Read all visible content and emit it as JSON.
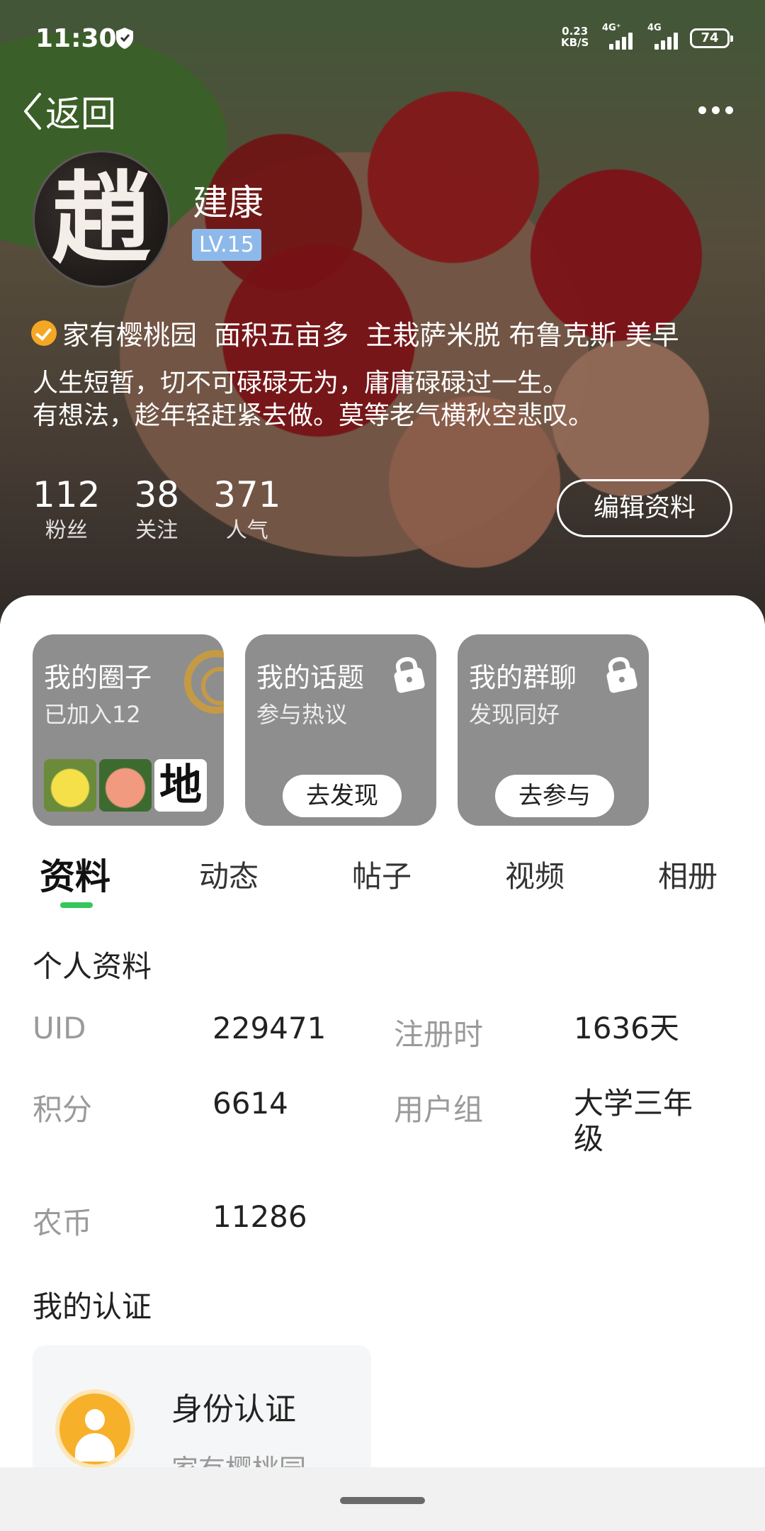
{
  "status_bar": {
    "time": "11:30",
    "net_speed_value": "0.23",
    "net_speed_unit": "KB/S",
    "signal1_label": "4G⁺",
    "signal2_label": "4G",
    "battery": "74"
  },
  "header": {
    "back_label": "返回",
    "avatar_glyph": "趙",
    "username": "建康",
    "level": "LV.15",
    "verification": "家有樱桃园  面积五亩多  主栽萨米脱 布鲁克斯 美早",
    "bio_line1": "人生短暂，切不可碌碌无为，庸庸碌碌过一生。",
    "bio_line2": "有想法，趁年轻赶紧去做。莫等老气横秋空悲叹。",
    "stats": [
      {
        "value": "112",
        "label": "粉丝"
      },
      {
        "value": "38",
        "label": "关注"
      },
      {
        "value": "371",
        "label": "人气"
      }
    ],
    "edit_button": "编辑资料"
  },
  "cards": [
    {
      "title": "我的圈子",
      "subtitle": "已加入12",
      "thumb_char": "地"
    },
    {
      "title": "我的话题",
      "subtitle": "参与热议",
      "button": "去发现"
    },
    {
      "title": "我的群聊",
      "subtitle": "发现同好",
      "button": "去参与"
    }
  ],
  "tabs": [
    "资料",
    "动态",
    "帖子",
    "视频",
    "相册"
  ],
  "active_tab": "资料",
  "profile": {
    "section_title": "个人资料",
    "fields": [
      {
        "key": "UID",
        "value": "229471"
      },
      {
        "key": "注册时",
        "value": "1636天"
      },
      {
        "key": "积分",
        "value": "6614"
      },
      {
        "key": "用户组",
        "value": "大学三年级"
      },
      {
        "key": "农币",
        "value": "11286"
      }
    ]
  },
  "certification": {
    "section_title": "我的认证",
    "title": "身份认证",
    "subtitle": "家有樱桃园"
  },
  "colors": {
    "accent_green": "#34c759",
    "level_badge": "#8db9ea",
    "verify_badge": "#f5a623",
    "card_bg": "#8e8e8e"
  }
}
